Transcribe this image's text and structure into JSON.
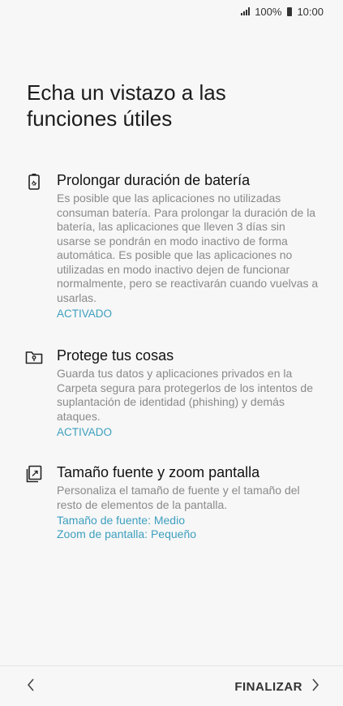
{
  "status_bar": {
    "battery": "100%",
    "time": "10:00"
  },
  "title": "Echa un vistazo a las funciones útiles",
  "features": [
    {
      "icon": "battery-recycle-icon",
      "title": "Prolongar duración de batería",
      "description": "Es posible que las aplicaciones no utilizadas consuman batería. Para prolongar la duración de la batería, las aplicaciones que lleven 3 días sin usarse se pondrán en modo inactivo de forma automática. Es posible que las aplicaciones no utilizadas en modo inactivo dejen de funcionar normalmente, pero se reactivarán cuando vuelvas a usarlas.",
      "status": "ACTIVADO"
    },
    {
      "icon": "secure-folder-icon",
      "title": "Protege tus cosas",
      "description": "Guarda tus datos y aplicaciones privados en la Carpeta segura para protegerlos de los intentos de suplantación de identidad (phishing) y demás ataques.",
      "status": "ACTIVADO"
    },
    {
      "icon": "font-zoom-icon",
      "title": "Tamaño fuente y zoom pantalla",
      "description": "Personaliza el tamaño de fuente y el tamaño del resto de elementos de la pantalla.",
      "font_size_label": "Tamaño de fuente: Medio",
      "zoom_label": "Zoom de pantalla: Pequeño"
    }
  ],
  "navigation": {
    "back_icon": "chevron-left-icon",
    "finish_label": "FINALIZAR",
    "finish_icon": "chevron-right-icon"
  }
}
